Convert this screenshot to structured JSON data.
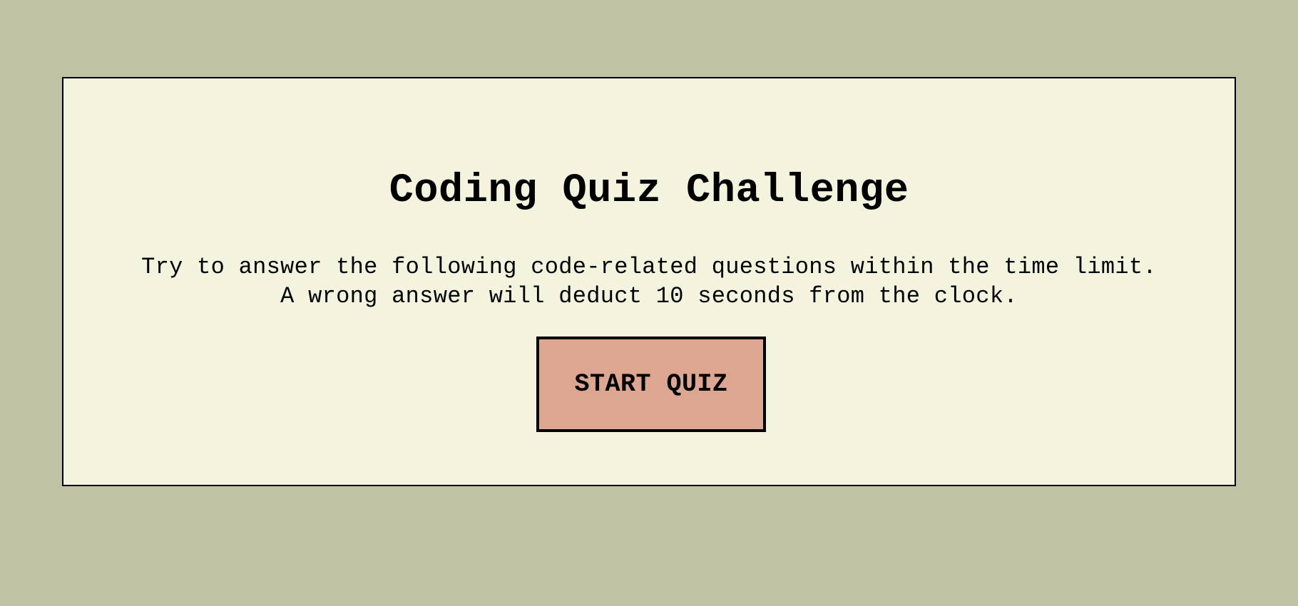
{
  "colors": {
    "page_background": "#bfc2a3",
    "card_background": "#f4f4de",
    "button_background": "#dca690",
    "border": "#000000"
  },
  "quiz": {
    "title": "Coding Quiz Challenge",
    "description": "Try to answer the following code-related questions within the time limit. A wrong answer will deduct 10 seconds from the clock.",
    "start_button_label": "START QUIZ"
  }
}
